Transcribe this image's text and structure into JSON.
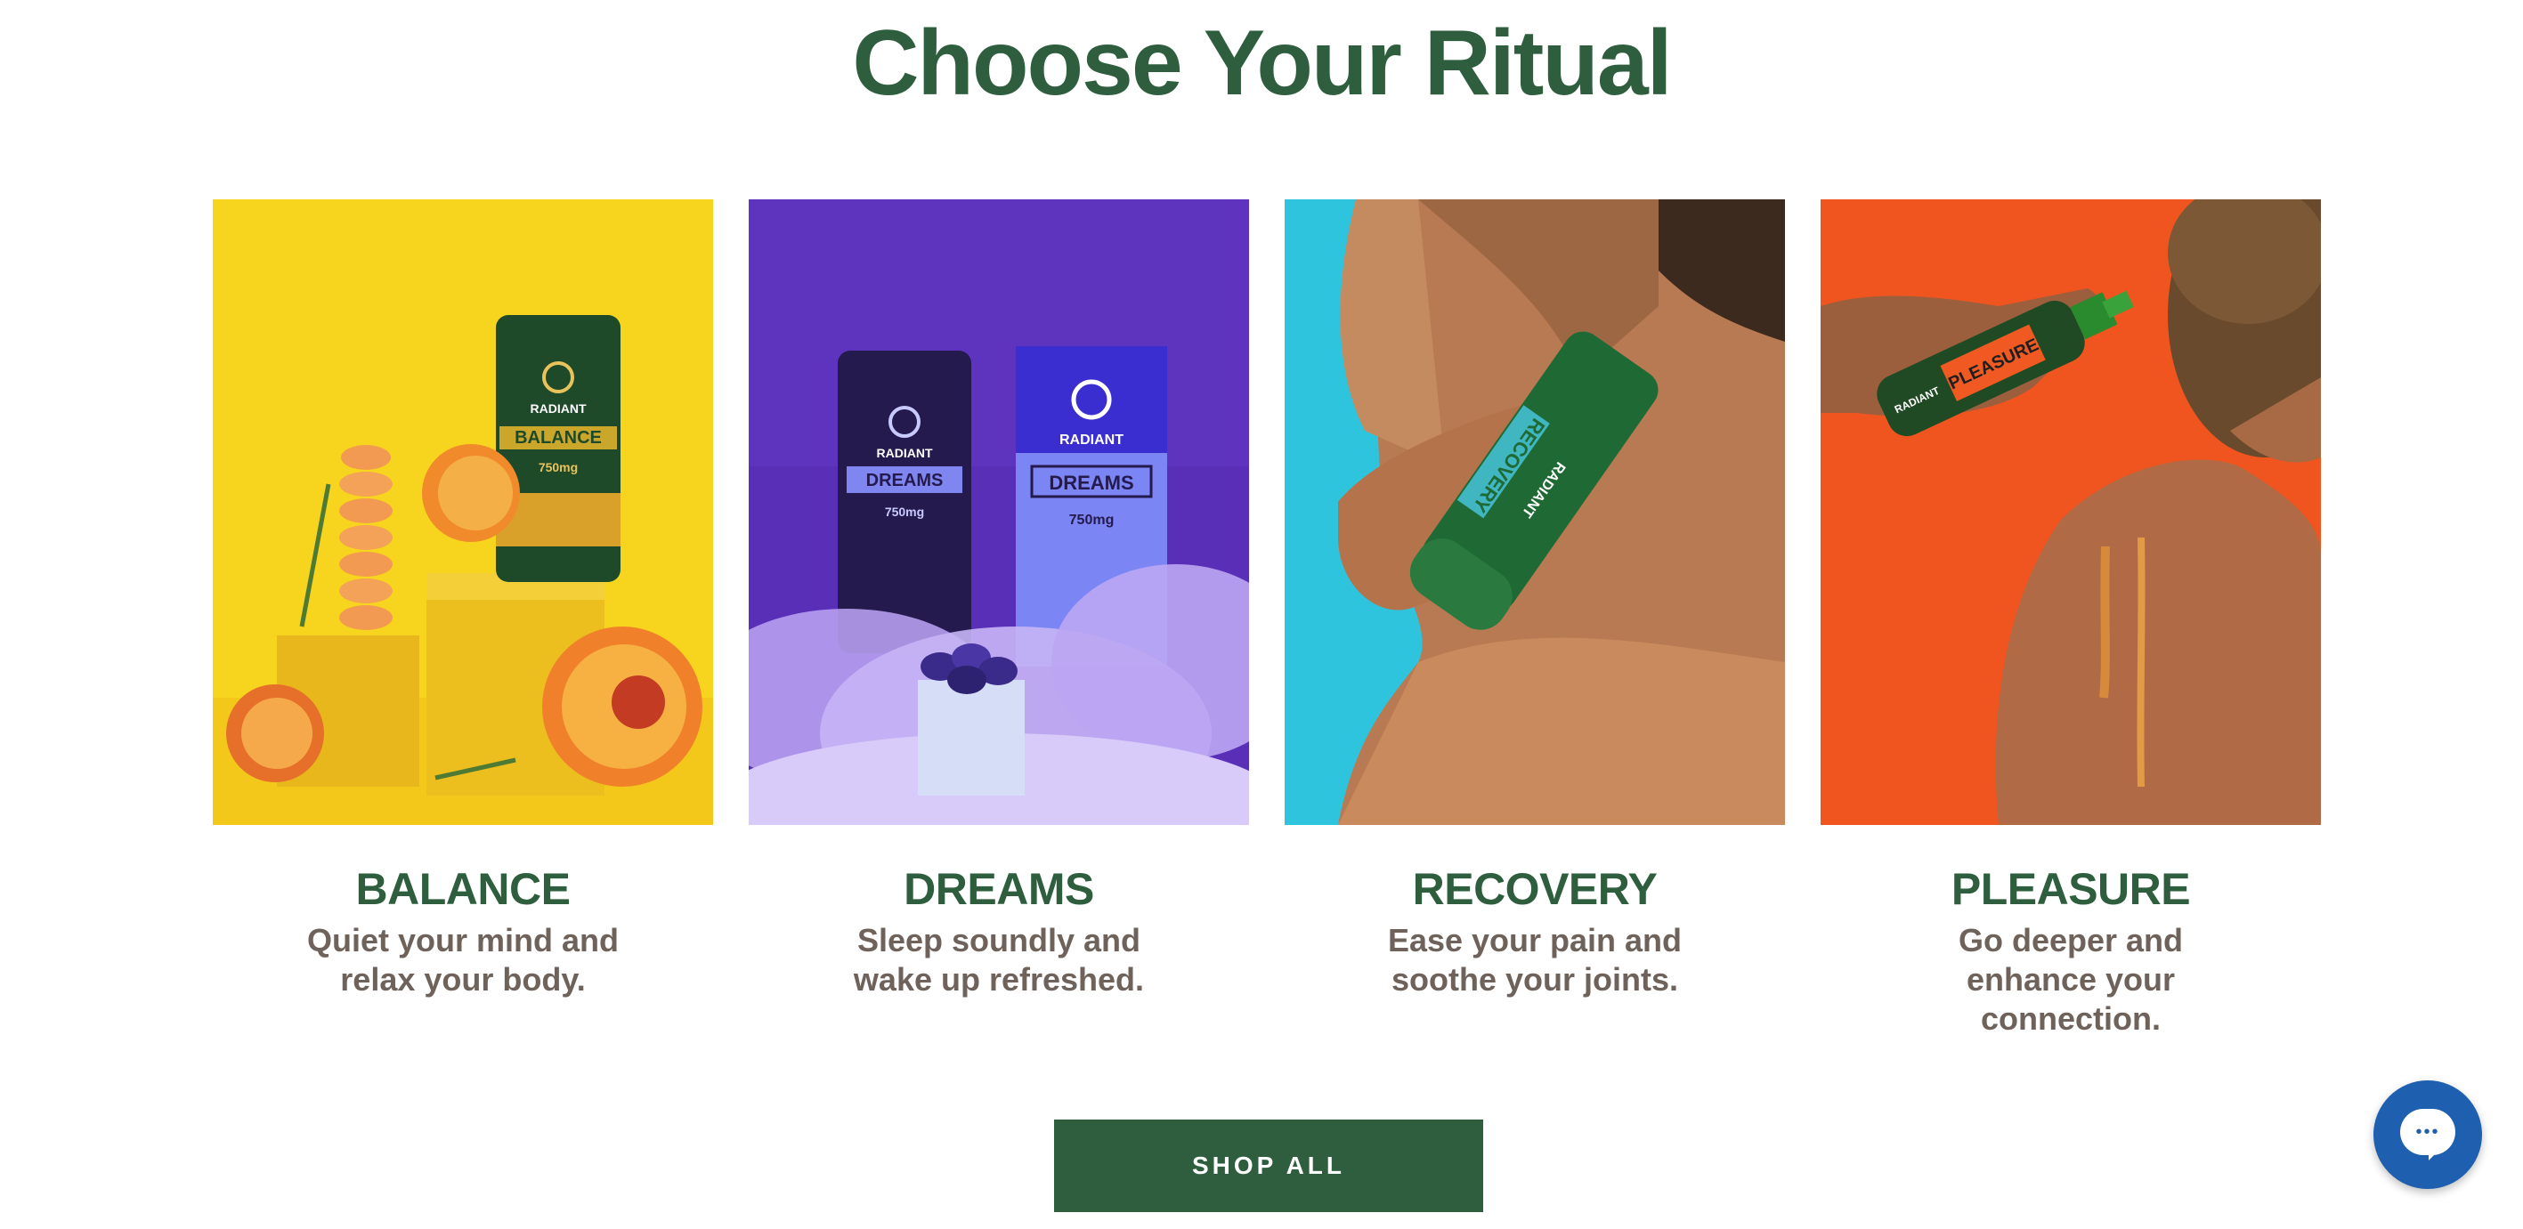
{
  "section": {
    "title": "Choose Your Ritual"
  },
  "cards": [
    {
      "name": "BALANCE",
      "desc": "Quiet your mind and relax your body.",
      "bg": "#f7d51e",
      "product_brand": "RADIANT",
      "product_label": "BALANCE",
      "product_dose": "750mg"
    },
    {
      "name": "DREAMS",
      "desc": "Sleep soundly and wake up refreshed.",
      "bg": "#5a2fb8",
      "product_brand": "RADIANT",
      "product_label": "DREAMS",
      "product_dose": "750mg"
    },
    {
      "name": "RECOVERY",
      "desc": "Ease your pain and soothe your joints.",
      "bg": "#2fc4dd",
      "product_brand": "RADIANT",
      "product_label": "RECOVERY",
      "product_dose": ""
    },
    {
      "name": "PLEASURE",
      "desc": "Go deeper and enhance your connection.",
      "bg": "#f0551f",
      "product_brand": "RADIANT",
      "product_label": "PLEASURE",
      "product_dose": ""
    }
  ],
  "cta": {
    "shop_all": "SHOP ALL"
  },
  "chat": {
    "dots": "•••"
  },
  "colors": {
    "brand_green": "#2e5e3e",
    "text_muted": "#6e625a",
    "chat_blue": "#1f5fb0"
  }
}
